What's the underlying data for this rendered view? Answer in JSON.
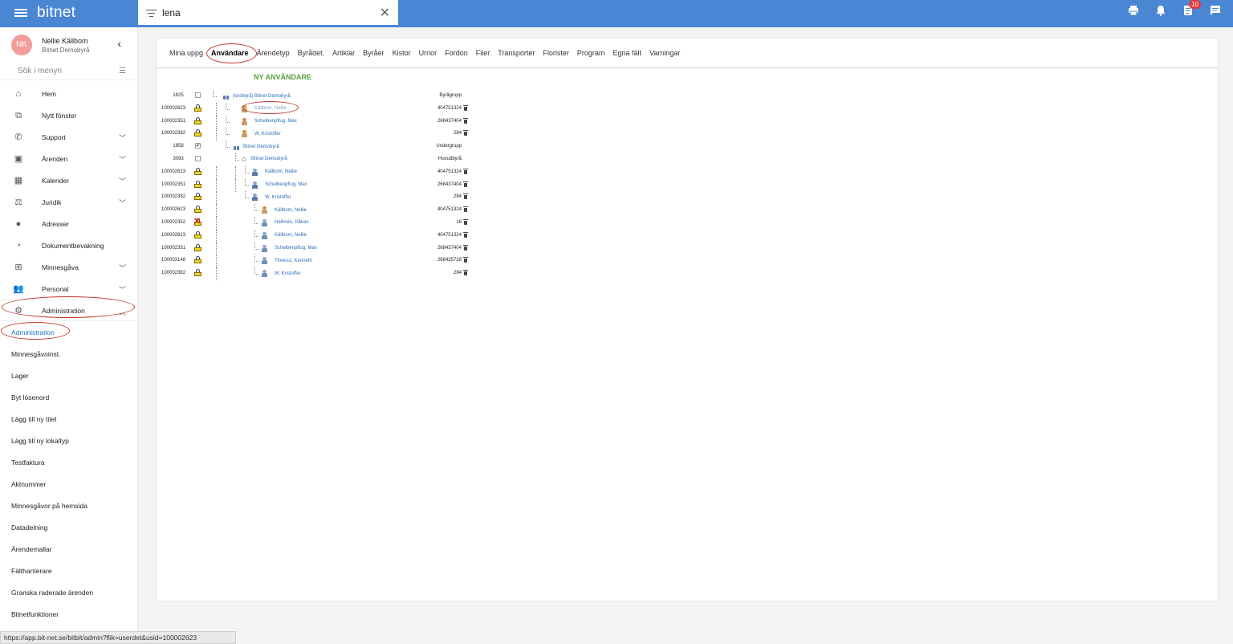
{
  "app": {
    "logo": "bitnet"
  },
  "search": {
    "value": "lena"
  },
  "header": {
    "notifications_badge": "10"
  },
  "user": {
    "initials": "NK",
    "name": "Nellie Källbom",
    "org": "Bitnet Demobyrå"
  },
  "sidebar": {
    "search_placeholder": "Sök i menyn",
    "items": [
      {
        "label": "Hem",
        "icon": "home-icon"
      },
      {
        "label": "Nytt fönster",
        "icon": "open-in-new-icon"
      },
      {
        "label": "Support",
        "icon": "phone-icon"
      },
      {
        "label": "Ärenden",
        "icon": "assignment-icon"
      },
      {
        "label": "Kalender",
        "icon": "calendar-icon"
      },
      {
        "label": "Juridik",
        "icon": "gavel-icon"
      },
      {
        "label": "Adresser",
        "icon": "location-pin-icon"
      },
      {
        "label": "Dokumentbevakning",
        "icon": "document-watch-icon"
      },
      {
        "label": "Minnesgåva",
        "icon": "gift-icon"
      },
      {
        "label": "Personal",
        "icon": "people-icon"
      },
      {
        "label": "Administration",
        "icon": "gear-icon"
      }
    ],
    "subitems": [
      "Administration",
      "Minnesgåvoinst.",
      "Lager",
      "Byt lösenord",
      "Lägg till ny titel",
      "Lägg till ny lokaltyp",
      "Testfaktura",
      "Aktnummer",
      "Minnesgåvor på hemsida",
      "Datadelning",
      "Ärendemallar",
      "Fälthanterare",
      "Granska raderade ärenden",
      "Bitnetfunktioner"
    ]
  },
  "tabs": [
    "Mina uppg",
    "Användare",
    "Ärendetyp",
    "Byrådet.",
    "Artiklar",
    "Byråer",
    "Kistor",
    "Urnor",
    "Fordon",
    "Filer",
    "Transporter",
    "Florister",
    "Program",
    "Egna fält",
    "Varningar"
  ],
  "new_user_label": "NY ANVÄNDARE",
  "tree": [
    {
      "id": "1825",
      "state": "unchecked",
      "name": "(testbyrå) Bitnet Demobyrå",
      "type": "group",
      "value": "Byrågrupp",
      "trash": false
    },
    {
      "id": "100002623",
      "state": "lock",
      "name": "Källbom, Nellie",
      "type": "female",
      "value": "404751324",
      "trash": true
    },
    {
      "id": "100002351",
      "state": "lock",
      "name": "Scheibenpflug, Max",
      "type": "female",
      "value": "268437404",
      "trash": true
    },
    {
      "id": "100002382",
      "state": "lock",
      "name": "W, Kristoffer",
      "type": "female",
      "value": "284",
      "trash": true
    },
    {
      "id": "1858",
      "state": "checked",
      "name": "Bitnet Demobyrå",
      "type": "group",
      "value": "Undergrupp",
      "trash": false
    },
    {
      "id": "3093",
      "state": "unchecked",
      "name": "Bitnet Demobyrå",
      "type": "home",
      "value": "Huvudbyrå",
      "trash": false
    },
    {
      "id": "100002623",
      "state": "lock",
      "name": "Källbom, Nellie",
      "type": "me",
      "value": "404751324",
      "trash": true
    },
    {
      "id": "100002351",
      "state": "lock",
      "name": "Scheibenpflug, Max",
      "type": "me",
      "value": "268437404",
      "trash": true
    },
    {
      "id": "100002382",
      "state": "lock",
      "name": "W, Kristoffer",
      "type": "me",
      "value": "284",
      "trash": true
    },
    {
      "id": "100002623",
      "state": "lock",
      "name": "Källbom, Nellie",
      "type": "female",
      "value": "404751324",
      "trash": true
    },
    {
      "id": "100002352",
      "state": "blocked",
      "name": "Hallmén, Håkan",
      "type": "user",
      "value": "16",
      "trash": true
    },
    {
      "id": "100002623",
      "state": "lock",
      "name": "Källbom, Nellie",
      "type": "user",
      "value": "404751324",
      "trash": true
    },
    {
      "id": "100002351",
      "state": "lock",
      "name": "Scheibenpflug, Max",
      "type": "user",
      "value": "268437404",
      "trash": true
    },
    {
      "id": "100003148",
      "state": "lock",
      "name": "Timecut, Kenneth",
      "type": "user",
      "value": "268435728",
      "trash": true
    },
    {
      "id": "100002382",
      "state": "lock",
      "name": "W, Kristoffer",
      "type": "user",
      "value": "284",
      "trash": true
    }
  ],
  "status_url": "https://app.bit-net.se/bitbit/admin?flik=userdet&usid=100002623"
}
